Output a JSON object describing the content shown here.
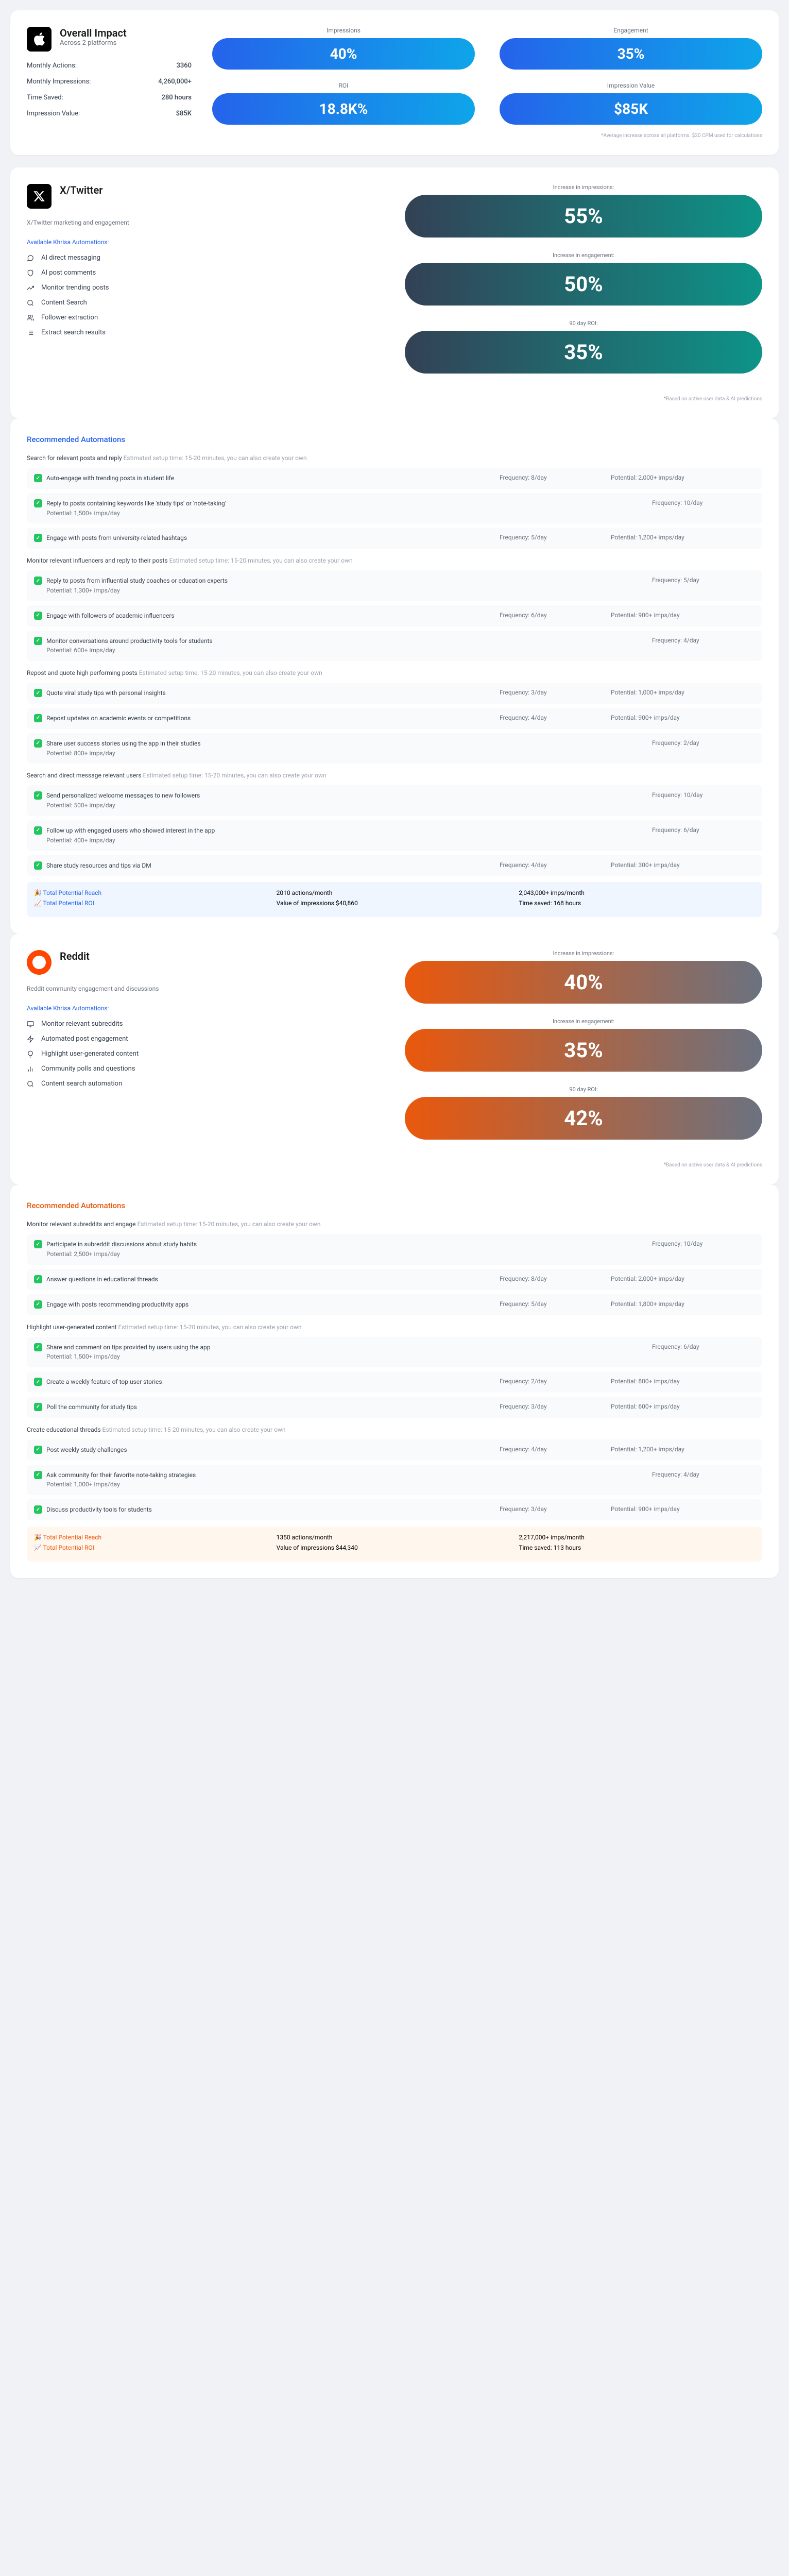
{
  "overall": {
    "title": "Overall Impact",
    "subtitle": "Across 2 platforms",
    "metrics": [
      {
        "label": "Monthly Actions:",
        "value": "3360"
      },
      {
        "label": "Monthly Impressions:",
        "value": "4,260,000+"
      },
      {
        "label": "Time Saved:",
        "value": "280 hours"
      },
      {
        "label": "Impression Value:",
        "value": "$85K"
      }
    ],
    "pills": [
      {
        "label": "Impressions",
        "value": "40%"
      },
      {
        "label": "Engagement",
        "value": "35%"
      },
      {
        "label": "ROI",
        "value": "18.8K%"
      },
      {
        "label": "Impression Value",
        "value": "$85K"
      }
    ],
    "footnote": "*Average increase across all platforms. $20 CPM used for calculations"
  },
  "platforms": [
    {
      "id": "tw",
      "name": "X/Twitter",
      "desc": "X/Twitter marketing and engagement",
      "icon": "x",
      "avail": "Available Khrisa Automations:",
      "features": [
        {
          "icon": "message",
          "label": "AI direct messaging"
        },
        {
          "icon": "shield",
          "label": "AI post comments"
        },
        {
          "icon": "trending",
          "label": "Monitor trending posts"
        },
        {
          "icon": "search",
          "label": "Content Search"
        },
        {
          "icon": "users",
          "label": "Follower extraction"
        },
        {
          "icon": "list",
          "label": "Extract search results"
        }
      ],
      "stats": [
        {
          "label": "Increase in impressions:",
          "value": "55%"
        },
        {
          "label": "Increase in engagement:",
          "value": "50%"
        },
        {
          "label": "90 day ROI:",
          "value": "35%"
        }
      ],
      "foot": "*Based on active user data & AI predictions",
      "recHead": "Recommended Automations",
      "sections": [
        {
          "name": "Search for relevant posts and reply",
          "meta": "Estimated setup time: 15-20 minutes, you can also create your own",
          "items": [
            {
              "text": "Auto-engage with trending posts in student life",
              "freq": "Frequency: 8/day",
              "pot": "Potential: 2,000+ imps/day"
            },
            {
              "text": "Reply to posts containing keywords like 'study tips' or 'note-taking'",
              "freq": "Frequency: 10/day",
              "potUnder": "Potential: 1,500+ imps/day"
            },
            {
              "text": "Engage with posts from university-related hashtags",
              "freq": "Frequency: 5/day",
              "pot": "Potential: 1,200+ imps/day"
            }
          ]
        },
        {
          "name": "Monitor relevant influencers and reply to their posts",
          "meta": "Estimated setup time: 15-20 minutes, you can also create your own",
          "items": [
            {
              "text": "Reply to posts from influential study coaches or education experts",
              "freq": "Frequency: 5/day",
              "potUnder": "Potential: 1,300+ imps/day"
            },
            {
              "text": "Engage with followers of academic influencers",
              "freq": "Frequency: 6/day",
              "pot": "Potential: 900+ imps/day"
            },
            {
              "text": "Monitor conversations around productivity tools for students",
              "freq": "Frequency: 4/day",
              "potUnder": "Potential: 600+ imps/day"
            }
          ]
        },
        {
          "name": "Repost and quote high performing posts",
          "meta": "Estimated setup time: 15-20 minutes, you can also create your own",
          "items": [
            {
              "text": "Quote viral study tips with personal insights",
              "freq": "Frequency: 3/day",
              "pot": "Potential: 1,000+ imps/day"
            },
            {
              "text": "Repost updates on academic events or competitions",
              "freq": "Frequency: 4/day",
              "pot": "Potential: 900+ imps/day"
            },
            {
              "text": "Share user success stories using the app in their studies",
              "freq": "Frequency: 2/day",
              "potUnder": "Potential: 800+ imps/day"
            }
          ]
        },
        {
          "name": "Search and direct message relevant users",
          "meta": "Estimated setup time: 15-20 minutes, you can also create your own",
          "items": [
            {
              "text": "Send personalized welcome messages to new followers",
              "freq": "Frequency: 10/day",
              "potUnder": "Potential: 500+ imps/day"
            },
            {
              "text": "Follow up with engaged users who showed interest in the app",
              "freq": "Frequency: 6/day",
              "potUnder": "Potential: 400+ imps/day"
            },
            {
              "text": "Share study resources and tips via DM",
              "freq": "Frequency: 4/day",
              "pot": "Potential: 300+ imps/day"
            }
          ]
        }
      ],
      "summary": {
        "reachLabel": "🎉 Total Potential Reach",
        "roiLabel": "📈 Total Potential ROI",
        "actions": "2010 actions/month",
        "imps": "2,043,000+ imps/month",
        "value": "Value of impressions $40,860",
        "time": "Time saved: 168 hours"
      }
    },
    {
      "id": "rd",
      "name": "Reddit",
      "desc": "Reddit community engagement and discussions",
      "icon": "reddit",
      "avail": "Available Khrisa Automations:",
      "features": [
        {
          "icon": "monitor",
          "label": "Monitor relevant subreddits"
        },
        {
          "icon": "bolt",
          "label": "Automated post engagement"
        },
        {
          "icon": "bulb",
          "label": "Highlight user-generated content"
        },
        {
          "icon": "poll",
          "label": "Community polls and questions"
        },
        {
          "icon": "search",
          "label": "Content search automation"
        }
      ],
      "stats": [
        {
          "label": "Increase in impressions:",
          "value": "40%"
        },
        {
          "label": "Increase in engagement:",
          "value": "35%"
        },
        {
          "label": "90 day ROI:",
          "value": "42%"
        }
      ],
      "foot": "*Based on active user data & AI predictions",
      "recHead": "Recommended Automations",
      "sections": [
        {
          "name": "Monitor relevant subreddits and engage",
          "meta": "Estimated setup time: 15-20 minutes, you can also create your own",
          "items": [
            {
              "text": "Participate in subreddit discussions about study habits",
              "freq": "Frequency: 10/day",
              "potUnder": "Potential: 2,500+ imps/day"
            },
            {
              "text": "Answer questions in educational threads",
              "freq": "Frequency: 8/day",
              "pot": "Potential: 2,000+ imps/day"
            },
            {
              "text": "Engage with posts recommending productivity apps",
              "freq": "Frequency: 5/day",
              "pot": "Potential: 1,800+ imps/day"
            }
          ]
        },
        {
          "name": "Highlight user-generated content",
          "meta": "Estimated setup time: 15-20 minutes, you can also create your own",
          "items": [
            {
              "text": "Share and comment on tips provided by users using the app",
              "freq": "Frequency: 6/day",
              "potUnder": "Potential: 1,500+ imps/day"
            },
            {
              "text": "Create a weekly feature of top user stories",
              "freq": "Frequency: 2/day",
              "pot": "Potential: 800+ imps/day"
            },
            {
              "text": "Poll the community for study tips",
              "freq": "Frequency: 3/day",
              "pot": "Potential: 600+ imps/day"
            }
          ]
        },
        {
          "name": "Create educational threads",
          "meta": "Estimated setup time: 15-20 minutes, you can also create your own",
          "items": [
            {
              "text": "Post weekly study challenges",
              "freq": "Frequency: 4/day",
              "pot": "Potential: 1,200+ imps/day"
            },
            {
              "text": "Ask community for their favorite note-taking strategies",
              "freq": "Frequency: 4/day",
              "potUnder": "Potential: 1,000+ imps/day"
            },
            {
              "text": "Discuss productivity tools for students",
              "freq": "Frequency: 3/day",
              "pot": "Potential: 900+ imps/day"
            }
          ]
        }
      ],
      "summary": {
        "reachLabel": "🎉 Total Potential Reach",
        "roiLabel": "📈 Total Potential ROI",
        "actions": "1350 actions/month",
        "imps": "2,217,000+ imps/month",
        "value": "Value of impressions $44,340",
        "time": "Time saved: 113 hours"
      }
    }
  ]
}
